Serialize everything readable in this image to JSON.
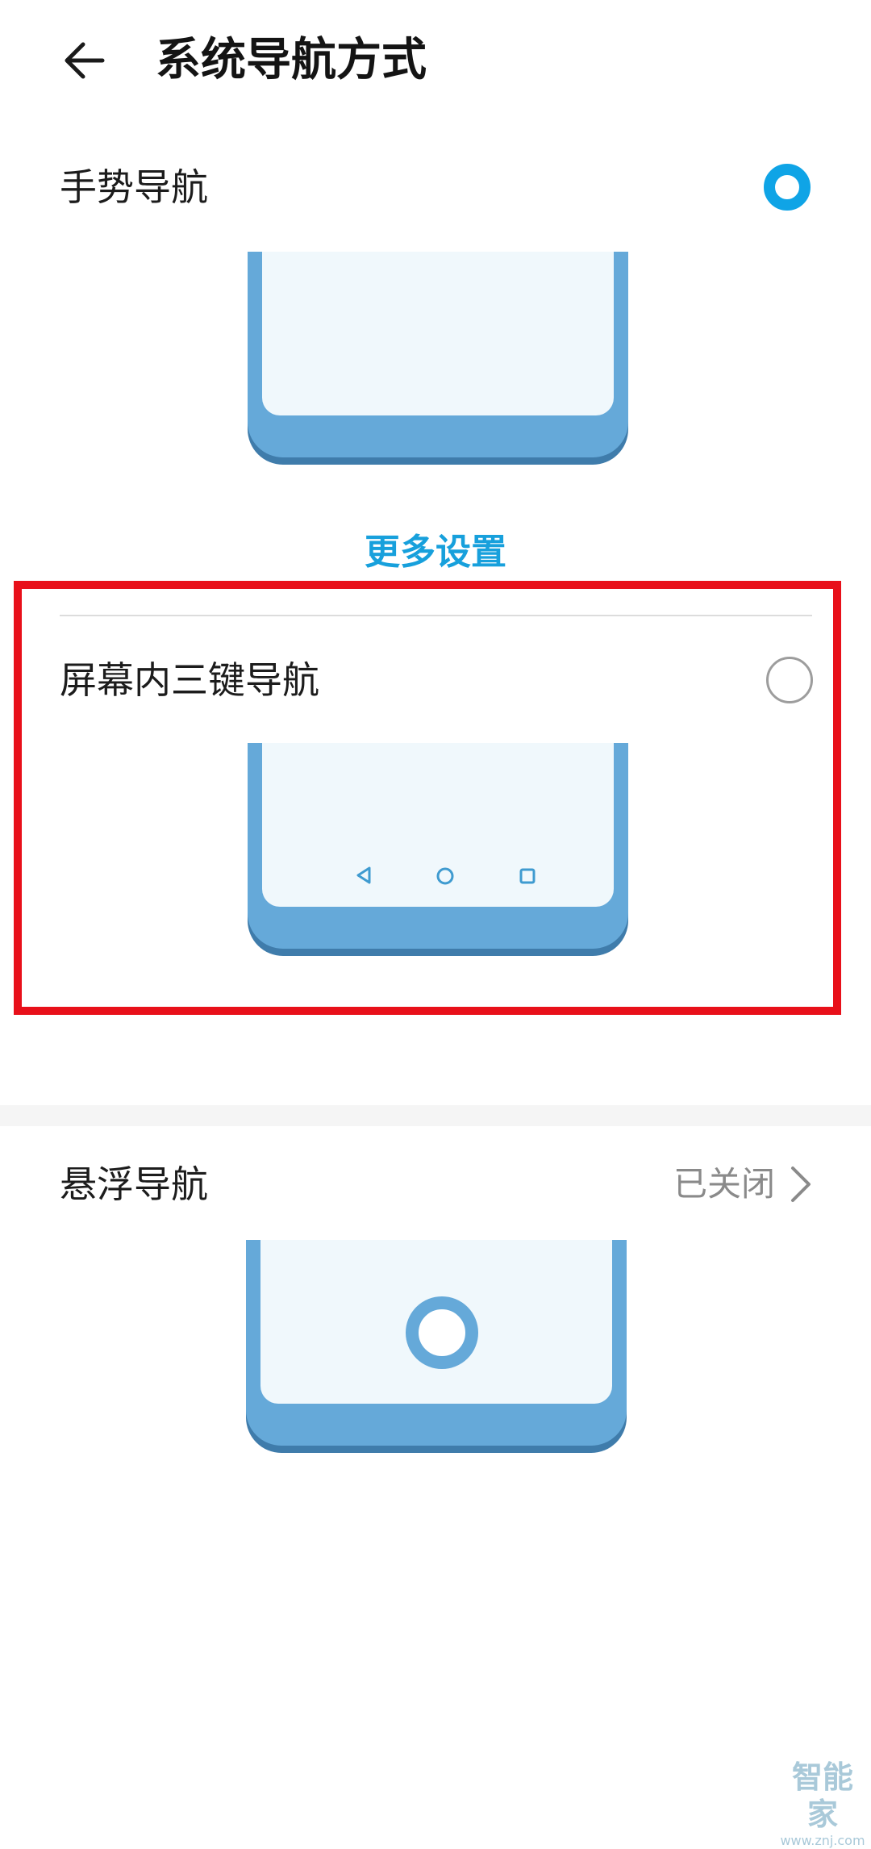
{
  "header": {
    "title": "系统导航方式"
  },
  "options": {
    "gesture": {
      "label": "手势导航",
      "selected": true,
      "more_settings": "更多设置"
    },
    "three_key": {
      "label": "屏幕内三键导航",
      "selected": false,
      "nav_icons": [
        "back-triangle-icon",
        "home-circle-icon",
        "recents-square-icon"
      ]
    },
    "floating": {
      "label": "悬浮导航",
      "status": "已关闭"
    }
  },
  "watermark": {
    "logo_text": "智能家",
    "url": "www.znj.com"
  },
  "colors": {
    "accent": "#0fa4e6",
    "highlight_border": "#e8101a",
    "phone_body": "#65a9d9",
    "phone_screen": "#f0f8fc"
  }
}
